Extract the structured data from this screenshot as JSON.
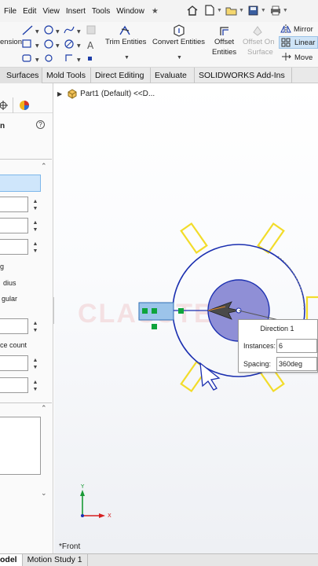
{
  "menu": {
    "items": [
      "File",
      "Edit",
      "View",
      "Insert",
      "Tools",
      "Window"
    ]
  },
  "ribbon": {
    "partial_left_label": "ension",
    "trim_entities": "Trim Entities",
    "convert_entities": "Convert Entities",
    "offset_entities_line1": "Offset",
    "offset_entities_line2": "Entities",
    "offset_on_surface_line1": "Offset On",
    "offset_on_surface_line2": "Surface",
    "mirror": "Mirror",
    "linear": "Linear",
    "move": "Move"
  },
  "tabs": [
    "Surfaces",
    "Mold Tools",
    "Direct Editing",
    "Evaluate",
    "SOLIDWORKS Add-Ins"
  ],
  "left_panel": {
    "title_fragment": "n",
    "opt_g": "g",
    "opt_radius": "dius",
    "opt_angular": "gular",
    "opt_instance_count": "ce count"
  },
  "tree": {
    "part_label": "Part1 (Default) <<D..."
  },
  "watermark": "CLASSTEC",
  "callout": {
    "title": "Direction 1",
    "instances_label": "Instances:",
    "instances_value": "6",
    "spacing_label": "Spacing:",
    "spacing_value": "360deg"
  },
  "axes": {
    "y": "Y",
    "x": "X"
  },
  "view_label": "*Front",
  "bottom_tabs": {
    "model": "odel",
    "motion": "Motion Study 1"
  },
  "colors": {
    "sketch_blue": "#1b2fb0",
    "slot_yellow": "#f2dc2a",
    "selection_blue": "#cfe6fb",
    "green_handle": "#0ea43c",
    "axis_red": "#d62020",
    "axis_green": "#1a9a36"
  }
}
